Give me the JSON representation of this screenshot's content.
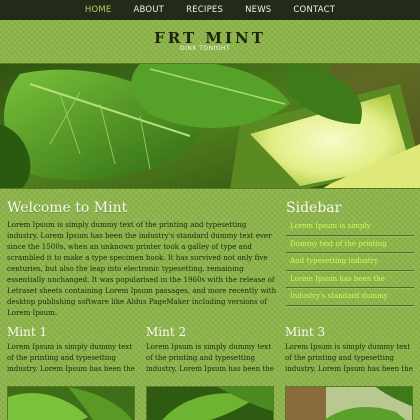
{
  "nav": {
    "items": [
      {
        "label": "HOME",
        "active": true
      },
      {
        "label": "ABOUT",
        "active": false
      },
      {
        "label": "RECIPES",
        "active": false
      },
      {
        "label": "NEWS",
        "active": false
      },
      {
        "label": "CONTACT",
        "active": false
      }
    ]
  },
  "header": {
    "logo": "FRT MINT",
    "tagline": "DINK TONIGHT"
  },
  "welcome": {
    "title": "Welcome to Mint",
    "body": "Lorem Ipsum is simply dummy text of the printing and typesetting industry. Lorem Ipsum has been the industry's standard dummy text ever since the 1500s, when an unknown printer took a galley of type and scrambled it to make a type specimen book. It has survived not only five centuries, but also the leap into electronic typesetting, remaining essentially unchanged. It was popularised in the 1960s with the release of Letraset sheets containing Lorem Ipsum passages, and more recently with desktop publishing software like Aldus PageMaker including versions of Lorem Ipsum."
  },
  "sidebar": {
    "title": "Sidebar",
    "items": [
      "Lorem Ipsum is simply",
      "Dummy text of the printing",
      "And typesetting industry",
      "Lorem Ipsum has been the",
      "Industry's standard dummy"
    ]
  },
  "columns": [
    {
      "title": "Mint 1",
      "body": "Lorem Ipsum is simply dummy text of the printing and typesetting industry. Lorem Ipsum has been the industry's standard dummy text ever"
    },
    {
      "title": "Mint 2",
      "body": "Lorem Ipsum is simply dummy text of the printing and typesetting industry. Lorem Ipsum has been the industry's standard dummy text ever"
    },
    {
      "title": "Mint 3",
      "body": "Lorem Ipsum is simply dummy text of the printing and typesetting industry. Lorem Ipsum has been the industry's standard dummy text ever"
    }
  ],
  "colors": {
    "background": "#8db64a",
    "nav_bg": "#242a1a",
    "nav_active": "#a9d35a",
    "sidebar_link": "#d4fb52"
  }
}
